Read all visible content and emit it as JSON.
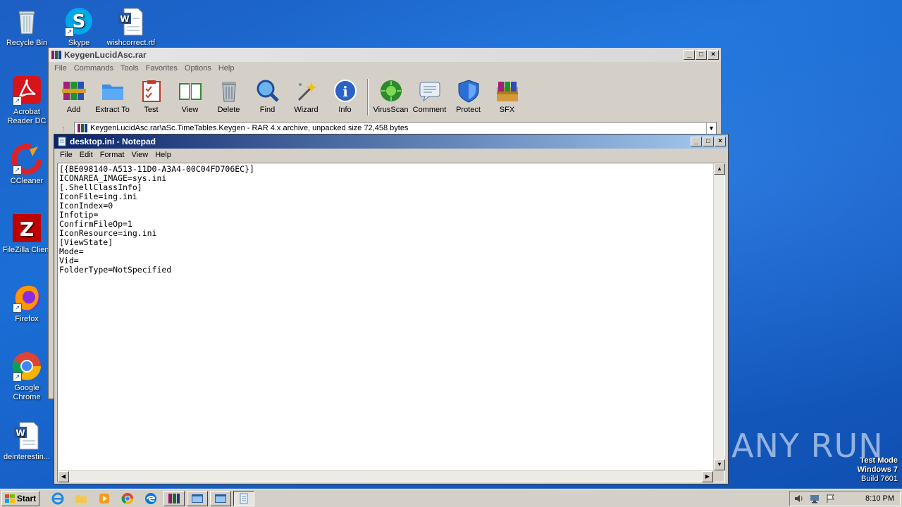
{
  "desktop": {
    "icons": [
      {
        "label": "Recycle Bin"
      },
      {
        "label": "Skype"
      },
      {
        "label": "wishcorrect.rtf"
      },
      {
        "label": "Acrobat Reader DC"
      },
      {
        "label": "CCleaner"
      },
      {
        "label": "FileZilla Client"
      },
      {
        "label": "Firefox"
      },
      {
        "label": "Google Chrome"
      },
      {
        "label": "deinterestin..."
      }
    ]
  },
  "winrar": {
    "title": "KeygenLucidAsc.rar",
    "menu": [
      "File",
      "Commands",
      "Tools",
      "Favorites",
      "Options",
      "Help"
    ],
    "tools": [
      "Add",
      "Extract To",
      "Test",
      "View",
      "Delete",
      "Find",
      "Wizard",
      "Info",
      "VirusScan",
      "Comment",
      "Protect",
      "SFX"
    ],
    "path": "KeygenLucidAsc.rar\\aSc.TimeTables.Keygen - RAR 4.x archive, unpacked size 72,458 bytes"
  },
  "notepad": {
    "title": "desktop.ini - Notepad",
    "menu": [
      "File",
      "Edit",
      "Format",
      "View",
      "Help"
    ],
    "content": "[{BE098140-A513-11D0-A3A4-00C04FD706EC}]\nICONAREA_IMAGE=sys.ini\n[.ShellClassInfo]\nIconFile=ing.ini\nIconIndex=0\nInfotip=\nConfirmFileOp=1\nIconResource=ing.ini\n[ViewState]\nMode=\nVid=\nFolderType=NotSpecified"
  },
  "window_buttons": {
    "minimize": "_",
    "maximize": "□",
    "close": "×"
  },
  "taskbar": {
    "start_label": "Start",
    "clock": "8:10 PM"
  },
  "watermark": {
    "text": "ANY RUN"
  },
  "system": {
    "line1": "Test Mode",
    "line2": "Windows 7",
    "line3": "Build 7601"
  },
  "colors": {
    "desktop": "#1a6fd6",
    "notepad_title": "#0a246a",
    "chrome_gray": "#d4d0c8"
  }
}
